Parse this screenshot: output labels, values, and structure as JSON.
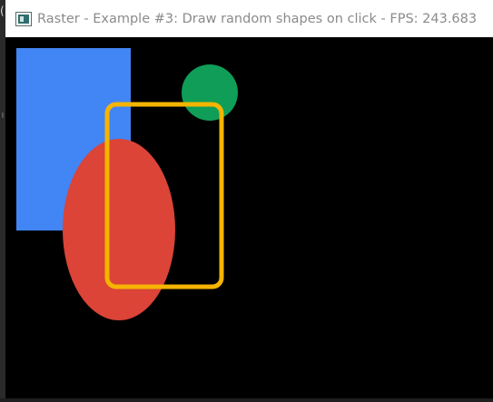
{
  "window": {
    "title": "Raster - Example #3: Draw random shapes on click - FPS: 243.683",
    "app_icon": "window-app-icon"
  },
  "background": {
    "edge_glyph": "("
  },
  "canvas": {
    "background_color": "#000000",
    "shapes": [
      {
        "type": "rectangle",
        "style": "filled",
        "color": "#4285F4"
      },
      {
        "type": "circle",
        "style": "filled",
        "color": "#0F9D58"
      },
      {
        "type": "ellipse",
        "style": "filled",
        "color": "#DB4437"
      },
      {
        "type": "rounded-rectangle",
        "style": "outline",
        "color": "#F4B400"
      }
    ]
  }
}
